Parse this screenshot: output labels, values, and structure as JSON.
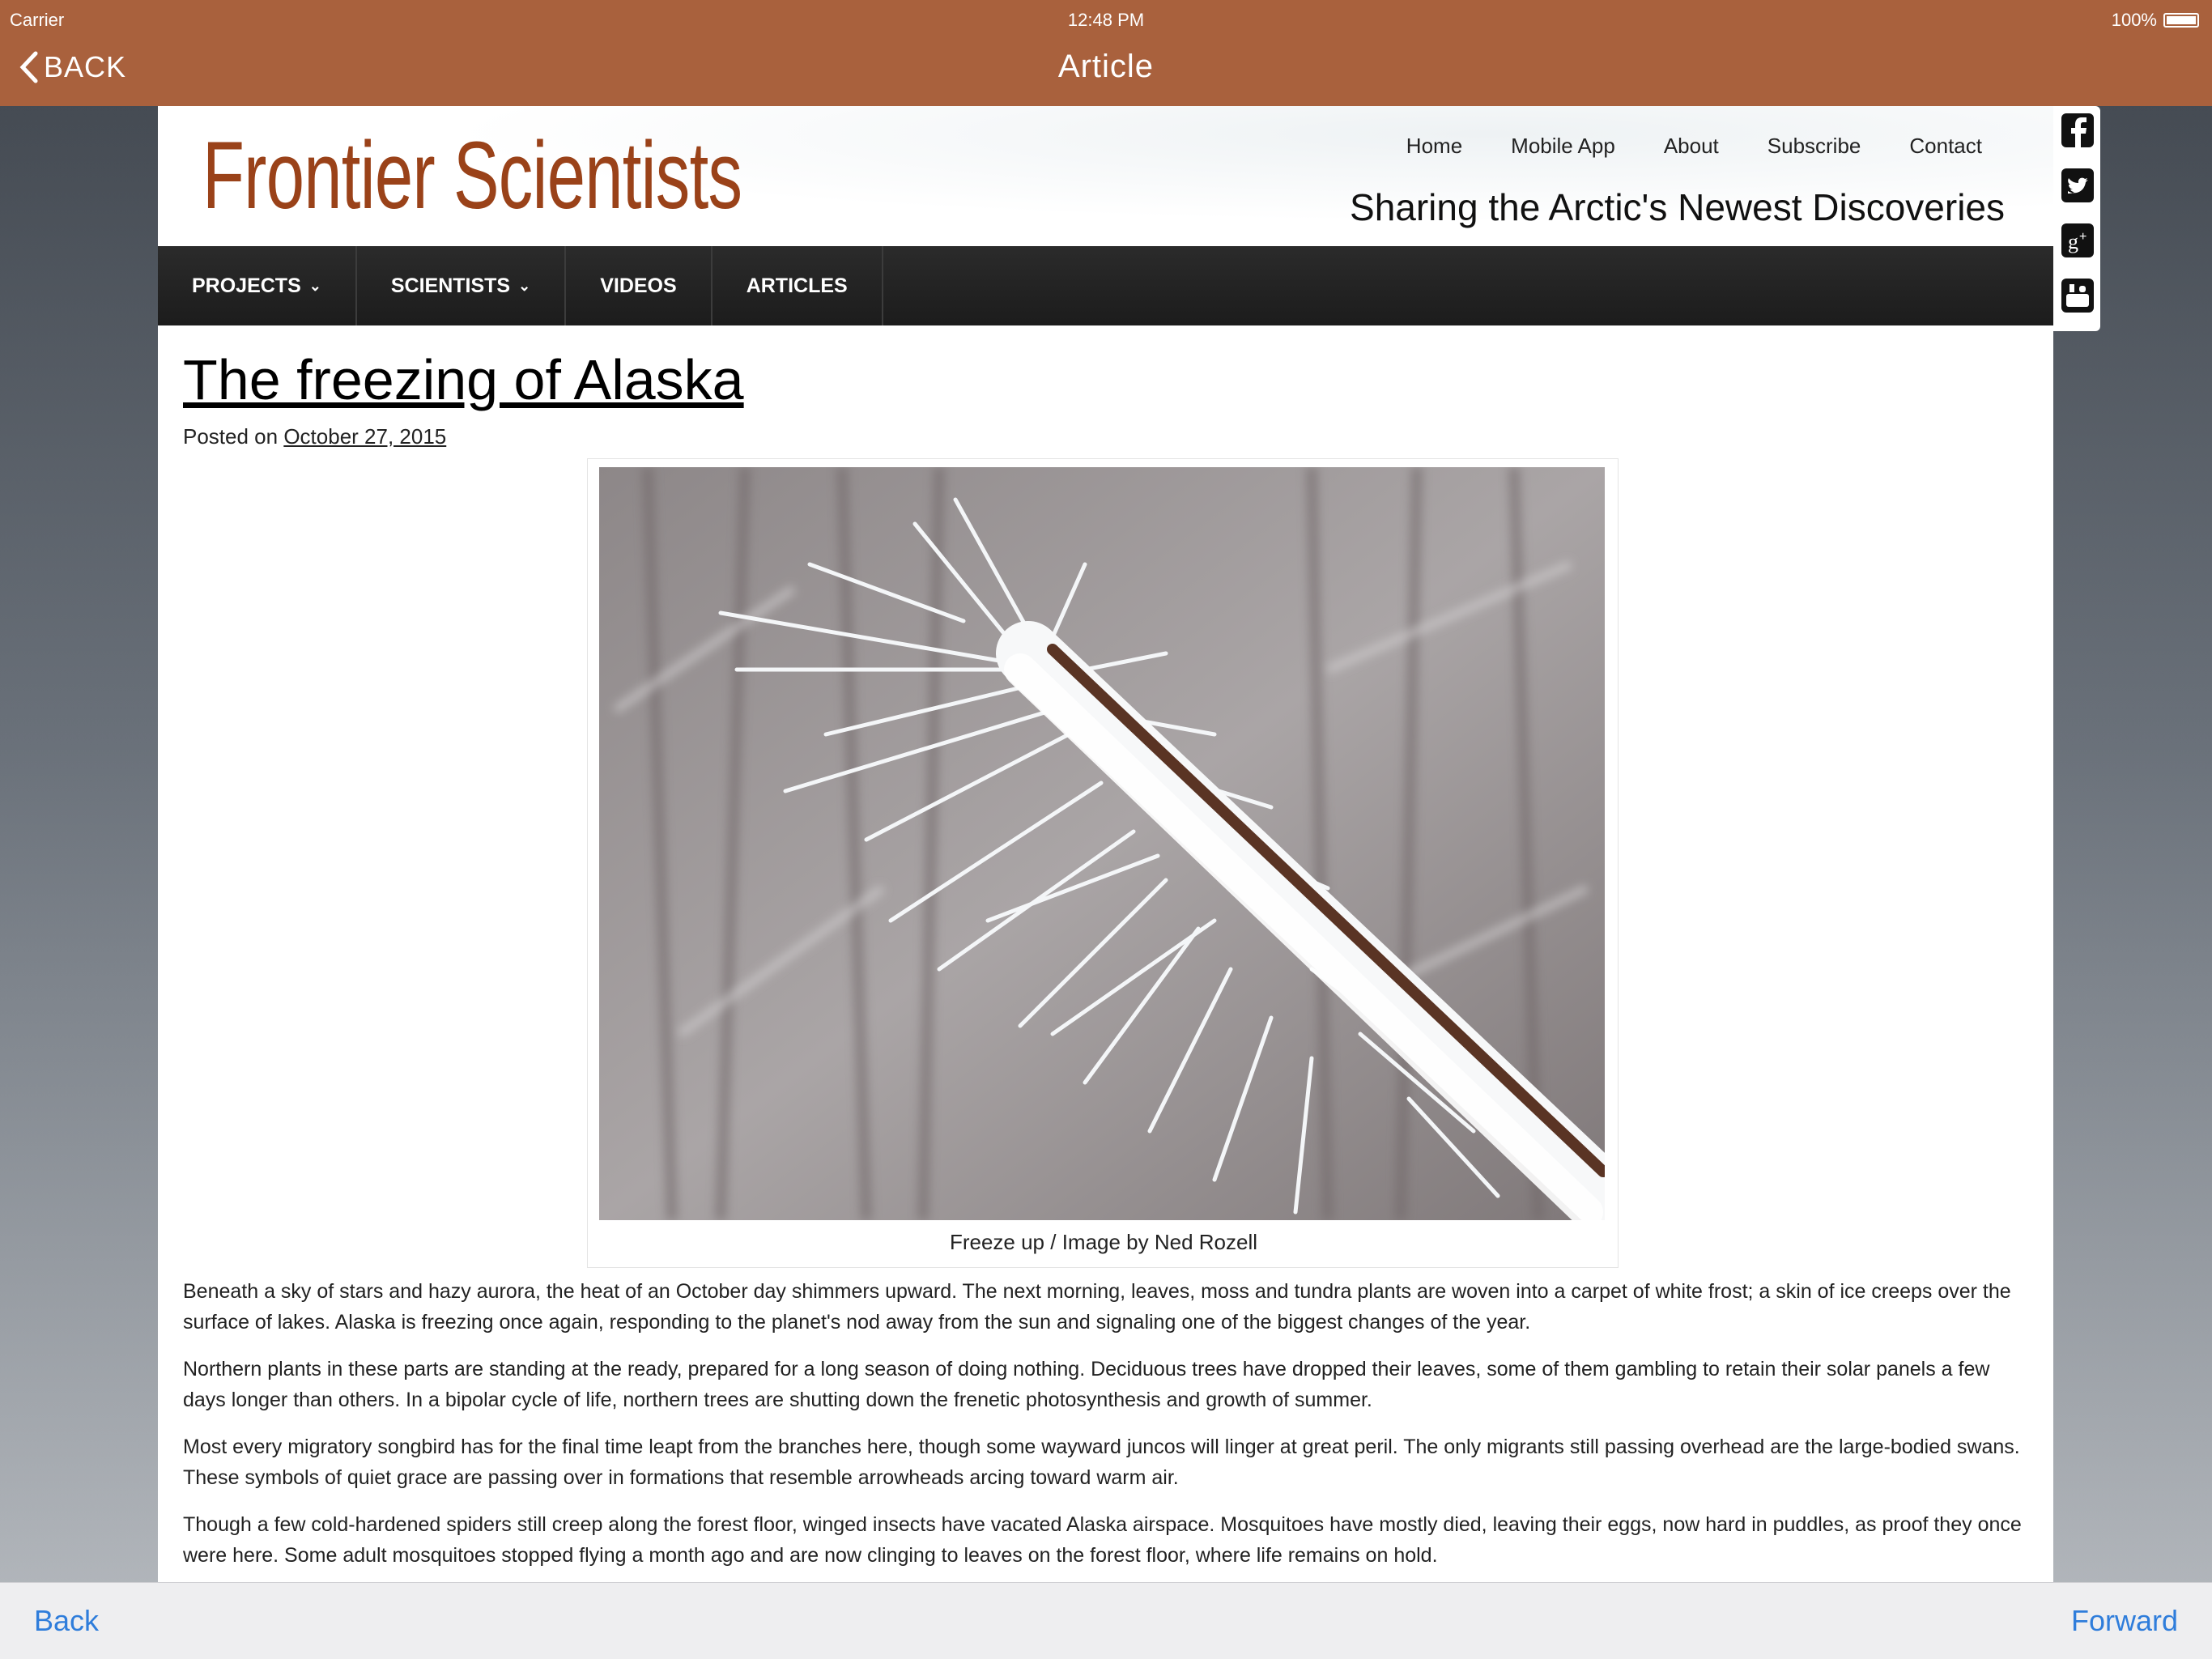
{
  "status_bar": {
    "carrier": "Carrier",
    "time": "12:48 PM",
    "battery": "100%"
  },
  "nav_bar": {
    "back_label": "BACK",
    "title": "Article"
  },
  "site": {
    "logo": "Frontier Scientists",
    "top_links": [
      "Home",
      "Mobile App",
      "About",
      "Subscribe",
      "Contact"
    ],
    "tagline": "Sharing the Arctic's Newest Discoveries",
    "main_nav": [
      {
        "label": "PROJECTS",
        "has_dropdown": true
      },
      {
        "label": "SCIENTISTS",
        "has_dropdown": true
      },
      {
        "label": "VIDEOS",
        "has_dropdown": false
      },
      {
        "label": "ARTICLES",
        "has_dropdown": false
      }
    ]
  },
  "article": {
    "title": "The freezing of Alaska",
    "posted_prefix": "Posted on",
    "posted_date": "October 27, 2015",
    "image_caption": "Freeze up / Image by Ned Rozell",
    "paragraphs": [
      "Beneath a sky of stars and hazy aurora, the heat of an October day shimmers upward. The next morning, leaves, moss and tundra plants are woven into a carpet of white frost; a skin of ice creeps over the surface of lakes. Alaska is freezing once again, responding to the planet's nod away from the sun and signaling one of the biggest changes of the year.",
      "Northern plants in these parts are standing at the ready, prepared for a long season of doing nothing. Deciduous trees have dropped their leaves, some of them gambling to retain their solar panels a few days longer than others. In a bipolar cycle of life, northern trees are shutting down the frenetic photosynthesis and growth of summer.",
      "Most every migratory songbird has for the final time leapt from the branches here, though some wayward juncos will linger at great peril. The only migrants still passing overhead are the large-bodied swans. These symbols of quiet grace are passing over in formations that resemble arrowheads arcing toward warm air.",
      "Though a few cold-hardened spiders still creep along the forest floor, winged insects have vacated Alaska airspace. Mosquitoes have mostly died, leaving their eggs, now hard in puddles, as proof they once were here. Some adult mosquitoes stopped flying a month ago and are now clinging to leaves on the forest floor, where life remains on hold."
    ]
  },
  "share_icons": [
    "facebook-icon",
    "twitter-icon",
    "google-plus-icon",
    "youtube-icon"
  ],
  "toolbar": {
    "back_label": "Back",
    "forward_label": "Forward"
  },
  "colors": {
    "app_bar": "#a9613d",
    "logo": "#9a4219",
    "nav_bg": "#222222",
    "link_blue": "#2f7ddb"
  }
}
